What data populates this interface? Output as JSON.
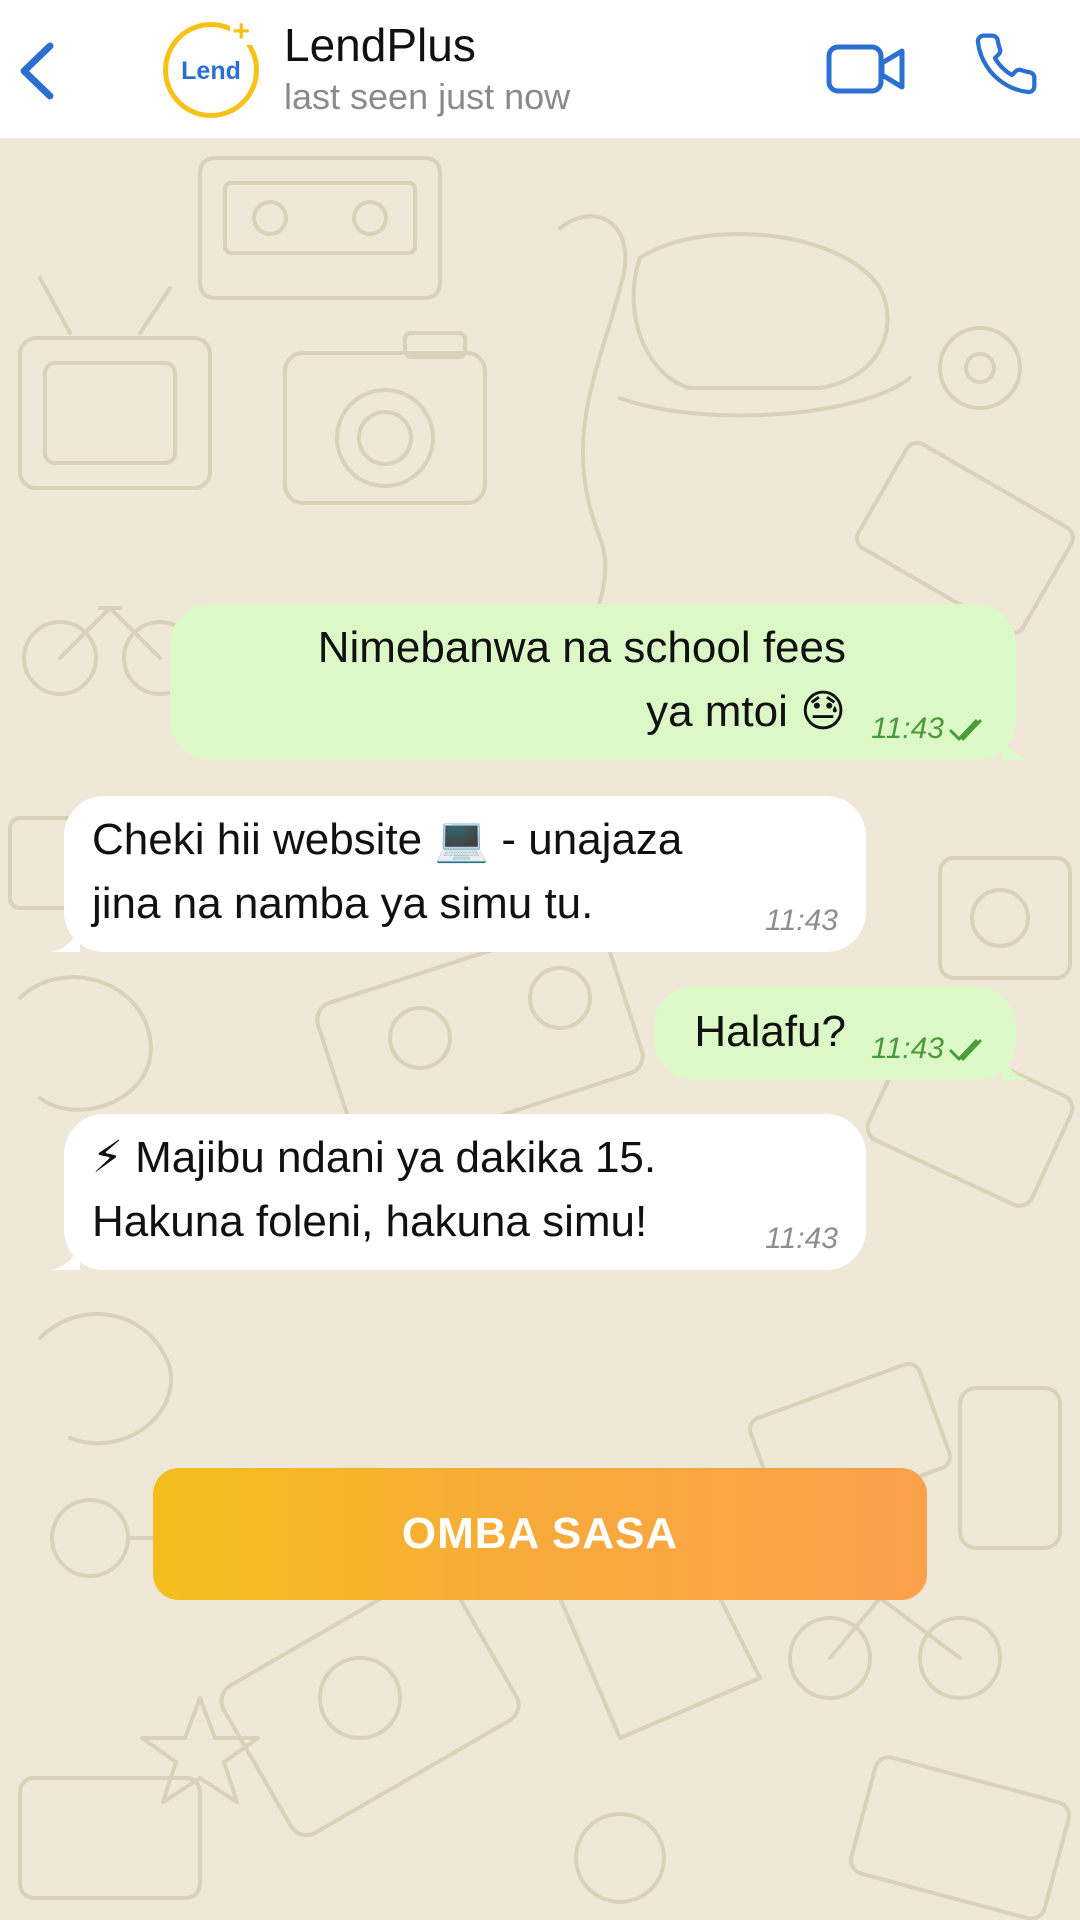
{
  "header": {
    "contact_name": "LendPlus",
    "status": "last seen just now",
    "avatar_text": "Lend",
    "avatar_badge": "+"
  },
  "messages": [
    {
      "direction": "outgoing",
      "lines": [
        "Nimebanwa na school fees",
        "ya mtoi 😓"
      ],
      "time": "11:43",
      "status": "read"
    },
    {
      "direction": "incoming",
      "lines": [
        "Cheki hii website 💻 - unajaza",
        "jina na namba ya simu tu."
      ],
      "time": "11:43"
    },
    {
      "direction": "outgoing",
      "lines": [
        "Halafu?"
      ],
      "time": "11:43",
      "status": "read"
    },
    {
      "direction": "incoming",
      "lines": [
        "⚡ Majibu ndani ya dakika 15.",
        "Hakuna foleni, hakuna simu!"
      ],
      "time": "11:43"
    }
  ],
  "cta": {
    "label": "OMBA SASA"
  },
  "colors": {
    "accent": "#2b6fd0",
    "outgoing_bubble": "#dcf8c6",
    "incoming_bubble": "#ffffff",
    "chat_background": "#efe7d7",
    "cta_gradient_start": "#f4bf1c",
    "cta_gradient_end": "#fba14c"
  },
  "icons": [
    "back-chevron-icon",
    "video-camera-icon",
    "phone-icon",
    "read-receipt-icon"
  ]
}
